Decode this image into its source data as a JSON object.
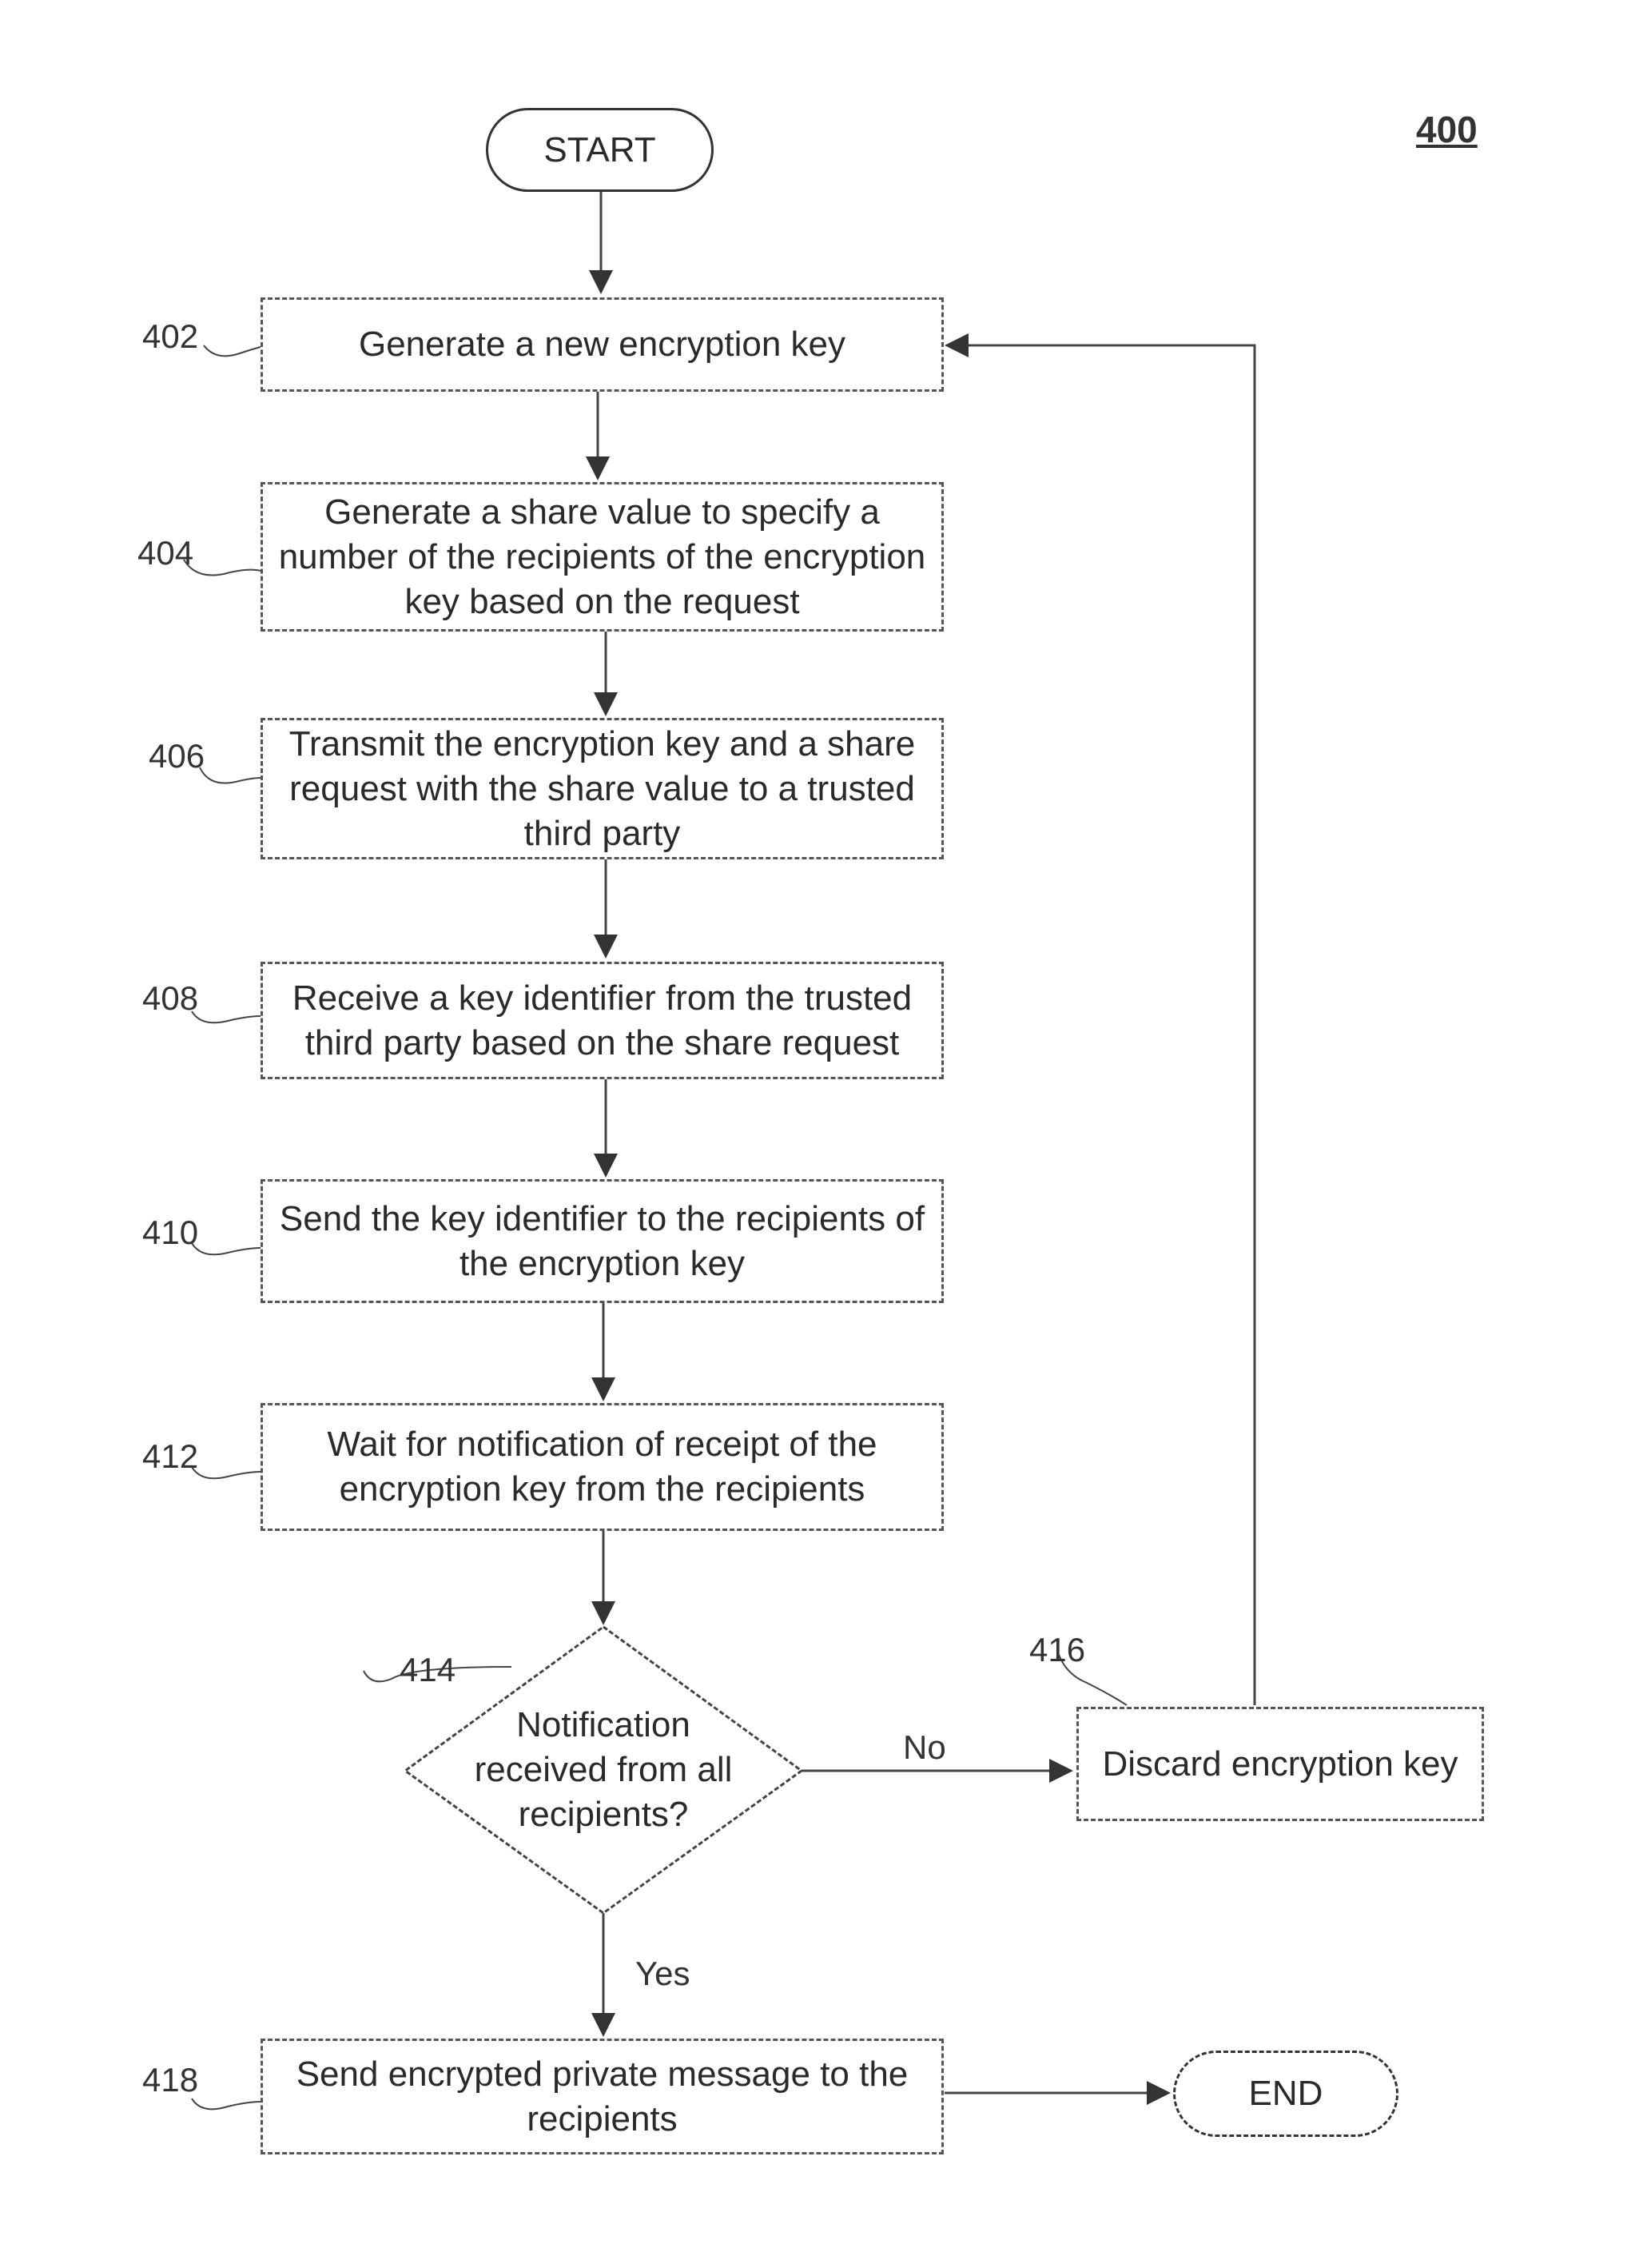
{
  "figure_number": "400",
  "start_label": "START",
  "end_label": "END",
  "steps": [
    {
      "ref": "402",
      "text": "Generate a new encryption key"
    },
    {
      "ref": "404",
      "text": "Generate a share value to specify a number of the recipients of the encryption key based on the request"
    },
    {
      "ref": "406",
      "text": "Transmit the encryption key and a share request with the share value to a trusted third party"
    },
    {
      "ref": "408",
      "text": "Receive a key identifier from the trusted third party based on the share request"
    },
    {
      "ref": "410",
      "text": "Send the key identifier to the recipients of the encryption key"
    },
    {
      "ref": "412",
      "text": "Wait for notification of receipt of the encryption key from the recipients"
    },
    {
      "ref": "414",
      "text": "Notification received from all recipients?"
    },
    {
      "ref": "416",
      "text": "Discard encryption key"
    },
    {
      "ref": "418",
      "text": "Send encrypted private message to the recipients"
    }
  ],
  "branches": {
    "no": "No",
    "yes": "Yes"
  }
}
